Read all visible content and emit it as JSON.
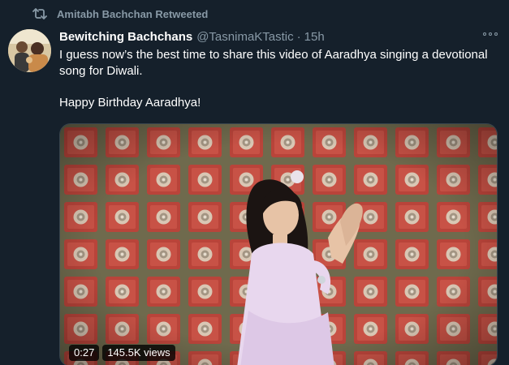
{
  "retweet": {
    "text": "Amitabh Bachchan Retweeted",
    "icon": "retweet-icon"
  },
  "tweet": {
    "display_name": "Bewitching Bachchans",
    "handle": "@TasnimaKTastic",
    "separator": "·",
    "time": "15h",
    "text_line1": "I guess now’s the best time to share this video of Aaradhya singing a devotional song for Diwali.",
    "text_line2": "Happy Birthday Aaradhya!"
  },
  "media": {
    "duration": "0:27",
    "views": "145.5K views"
  },
  "colors": {
    "background": "#15202b",
    "secondary_text": "#8899a6",
    "primary_text": "#ffffff"
  }
}
